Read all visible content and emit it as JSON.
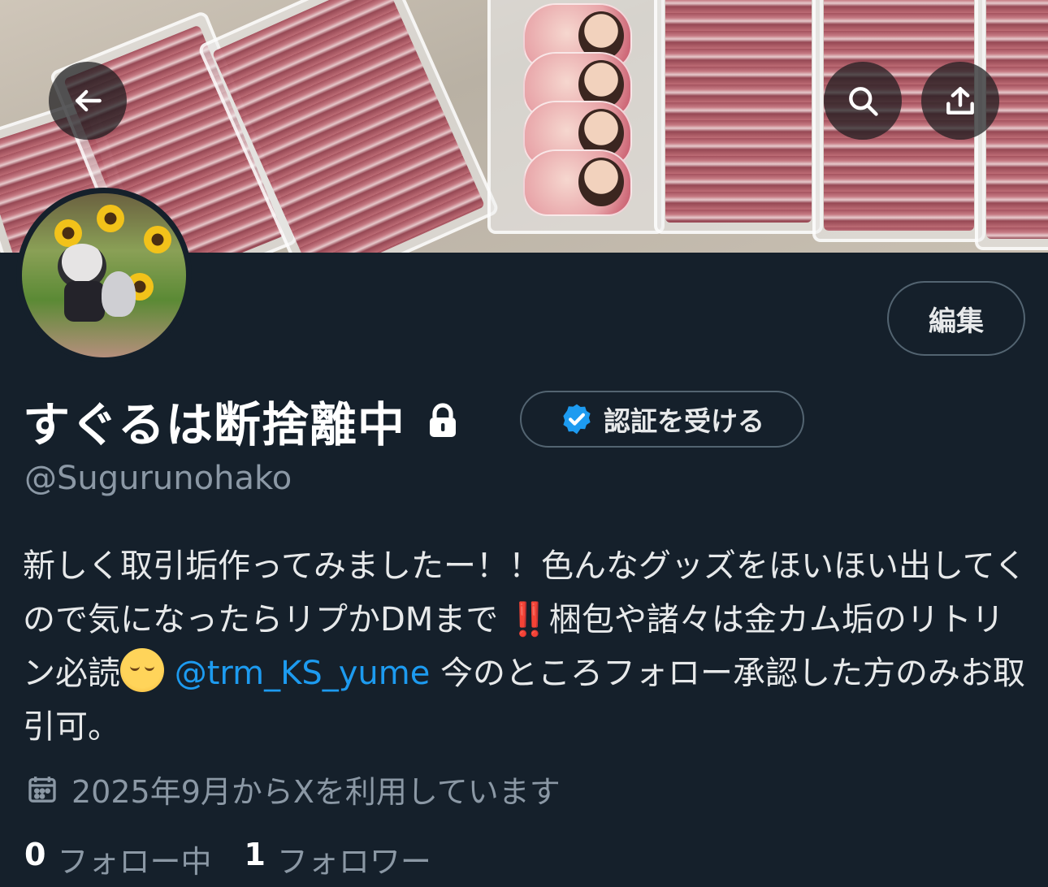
{
  "header": {
    "back_icon": "arrow-left-icon",
    "search_icon": "search-icon",
    "share_icon": "share-icon"
  },
  "profile": {
    "edit_label": "編集",
    "display_name": "すぐるは断捨離中",
    "lock_icon": "lock-icon",
    "verify_label": "認証を受ける",
    "verify_icon": "verified-badge-icon",
    "handle": "@Sugurunohako",
    "bio": {
      "part1": "新しく取引垢作ってみましたー！！色んなグッズをほいほい出してくので気になったらリプかDMまで",
      "emoji1": "‼️",
      "part2": "梱包や諸々は金カム垢のリトリン必読",
      "emoji2": "😌",
      "mention": "@trm_KS_yume",
      "part3": "今のところフォロー承認した方のみお取引可。"
    },
    "joined_icon": "calendar-icon",
    "joined": "2025年9月からXを利用しています",
    "following_count": "0",
    "following_label": "フォロー中",
    "followers_count": "1",
    "followers_label": "フォロワー"
  },
  "colors": {
    "background": "#15202b",
    "text": "#e7e9ea",
    "muted": "#8b98a5",
    "link": "#1d9bf0",
    "border": "#536471"
  }
}
